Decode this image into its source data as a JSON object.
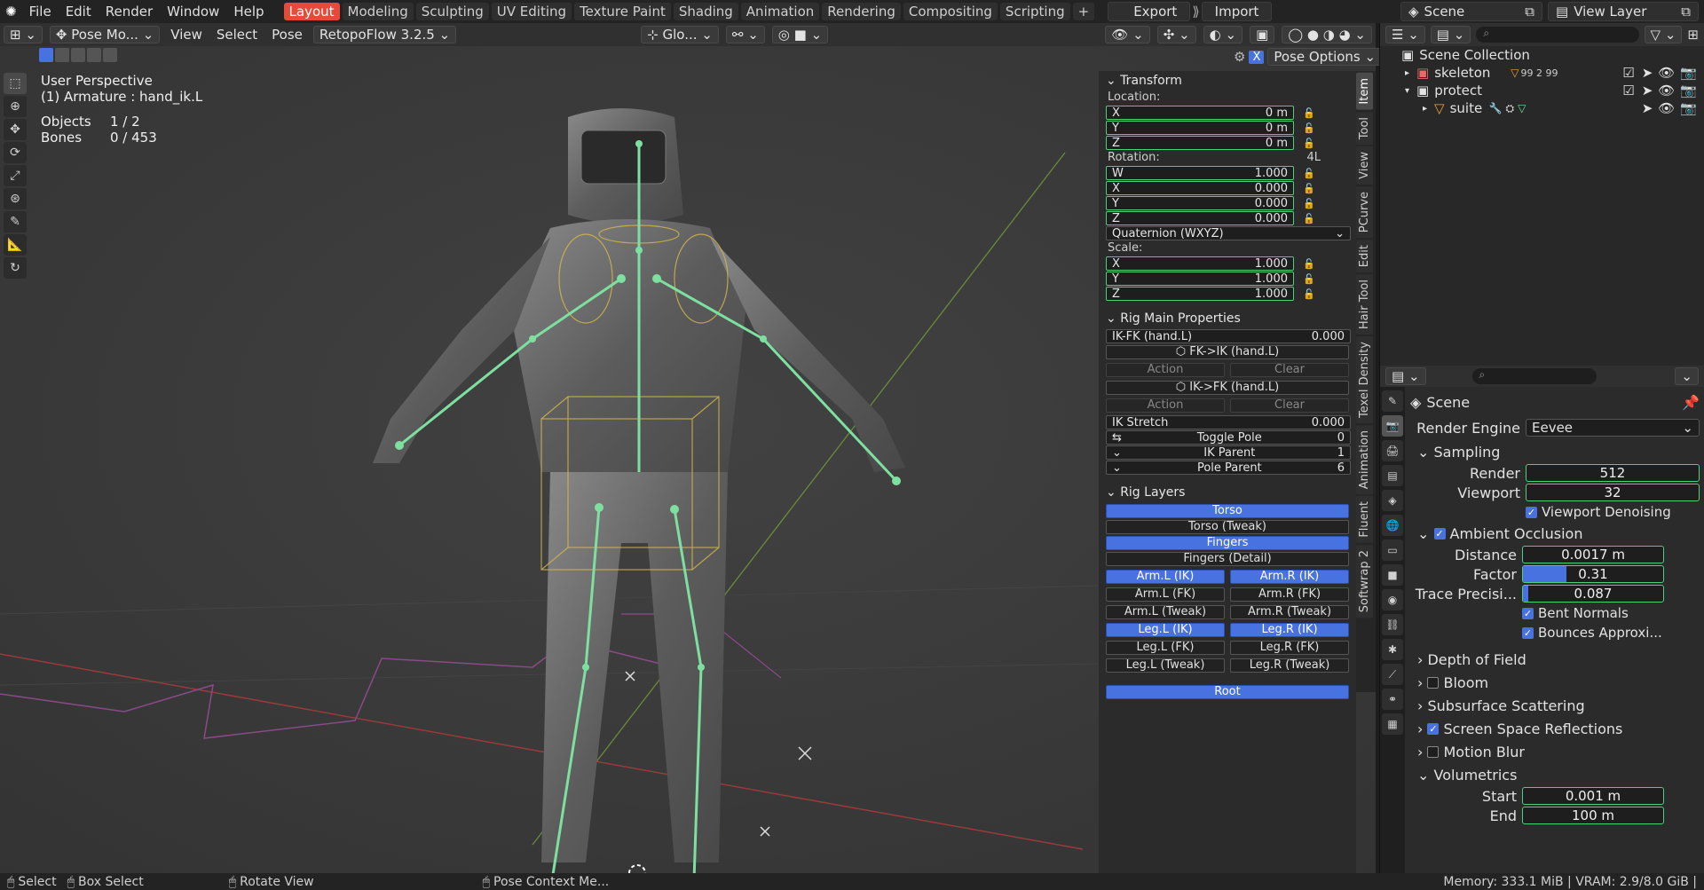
{
  "topbar": {
    "menus": [
      "File",
      "Edit",
      "Render",
      "Window",
      "Help"
    ],
    "workspaces": [
      "Layout",
      "Modeling",
      "Sculpting",
      "UV Editing",
      "Texture Paint",
      "Shading",
      "Animation",
      "Rendering",
      "Compositing",
      "Scripting"
    ],
    "active_workspace": "Layout",
    "export_label": "Export",
    "import_label": "Import",
    "scene": "Scene",
    "view_layer": "View Layer"
  },
  "viewport_header": {
    "mode": "Pose Mo...",
    "menus": [
      "View",
      "Select",
      "Pose"
    ],
    "addon": "RetopoFlow 3.2.5",
    "orientation": "Glo...",
    "pose_options": "Pose Options"
  },
  "viewport": {
    "perspective": "User Perspective",
    "armature": "(1) Armature : hand_ik.L",
    "objects_label": "Objects",
    "objects_value": "1 / 2",
    "bones_label": "Bones",
    "bones_value": "0 / 453"
  },
  "transform": {
    "title": "Transform",
    "location_label": "Location:",
    "location": [
      {
        "axis": "X",
        "value": "0 m"
      },
      {
        "axis": "Y",
        "value": "0 m"
      },
      {
        "axis": "Z",
        "value": "0 m"
      }
    ],
    "rotation_label": "Rotation:",
    "rotation_mode_short": "4L",
    "rotation": [
      {
        "axis": "W",
        "value": "1.000"
      },
      {
        "axis": "X",
        "value": "0.000"
      },
      {
        "axis": "Y",
        "value": "0.000"
      },
      {
        "axis": "Z",
        "value": "0.000"
      }
    ],
    "rotation_mode": "Quaternion (WXYZ)",
    "scale_label": "Scale:",
    "scale": [
      {
        "axis": "X",
        "value": "1.000"
      },
      {
        "axis": "Y",
        "value": "1.000"
      },
      {
        "axis": "Z",
        "value": "1.000"
      }
    ]
  },
  "rig_main": {
    "title": "Rig Main Properties",
    "ikfk_label": "IK-FK (hand.L)",
    "ikfk_value": "0.000",
    "fk_to_ik": "FK->IK (hand.L)",
    "ik_to_fk": "IK->FK (hand.L)",
    "action": "Action",
    "clear": "Clear",
    "ik_stretch_label": "IK Stretch",
    "ik_stretch_value": "0.000",
    "toggle_pole_label": "Toggle Pole",
    "toggle_pole_value": "0",
    "ik_parent_label": "IK Parent",
    "ik_parent_value": "1",
    "pole_parent_label": "Pole Parent",
    "pole_parent_value": "6"
  },
  "rig_layers": {
    "title": "Rig Layers",
    "torso": "Torso",
    "torso_tweak": "Torso (Tweak)",
    "fingers": "Fingers",
    "fingers_detail": "Fingers (Detail)",
    "pairs": [
      {
        "left": "Arm.L (IK)",
        "right": "Arm.R (IK)",
        "on": true
      },
      {
        "left": "Arm.L (FK)",
        "right": "Arm.R (FK)",
        "on": false
      },
      {
        "left": "Arm.L (Tweak)",
        "right": "Arm.R (Tweak)",
        "on": false
      },
      {
        "left": "Leg.L (IK)",
        "right": "Leg.R (IK)",
        "on": true
      },
      {
        "left": "Leg.L (FK)",
        "right": "Leg.R (FK)",
        "on": false
      },
      {
        "left": "Leg.L (Tweak)",
        "right": "Leg.R (Tweak)",
        "on": false
      }
    ],
    "root": "Root"
  },
  "vtabs": [
    "Item",
    "Tool",
    "View",
    "PCurve",
    "Edit",
    "Hair Tool",
    "Texel Density",
    "Animation",
    "Fluent",
    "Softwrap 2"
  ],
  "outliner": {
    "root": "Scene Collection",
    "rows": [
      {
        "name": "skeleton",
        "extra": "99 2  99"
      },
      {
        "name": "protect",
        "extra": ""
      },
      {
        "name": "suite",
        "extra": ""
      }
    ]
  },
  "properties": {
    "context": "Scene",
    "render_engine_label": "Render Engine",
    "render_engine": "Eevee",
    "sampling": "Sampling",
    "render_label": "Render",
    "render_value": "512",
    "viewport_label": "Viewport",
    "viewport_value": "32",
    "viewport_denoising": "Viewport Denoising",
    "ao": "Ambient Occlusion",
    "distance_label": "Distance",
    "distance_value": "0.0017 m",
    "factor_label": "Factor",
    "factor_value": "0.31",
    "factor_fraction": 0.31,
    "trace_label": "Trace Precisi...",
    "trace_value": "0.087",
    "bent_normals": "Bent Normals",
    "bounces": "Bounces Approxi...",
    "sections": [
      {
        "name": "Depth of Field",
        "check": null
      },
      {
        "name": "Bloom",
        "check": false
      },
      {
        "name": "Subsurface Scattering",
        "check": null
      },
      {
        "name": "Screen Space Reflections",
        "check": true
      },
      {
        "name": "Motion Blur",
        "check": false
      }
    ],
    "volumetrics": "Volumetrics",
    "start_label": "Start",
    "start_value": "0.001 m",
    "end_label": "End",
    "end_value": "100 m"
  },
  "statusbar": {
    "select": "Select",
    "box_select": "Box Select",
    "rotate_view": "Rotate View",
    "pose_context": "Pose Context Me...",
    "memory": "Memory: 333.1 MiB | VRAM: 2.9/8.0 GiB |"
  },
  "colors": {
    "accent_blue": "#4772e0",
    "active_tab": "#e64a3a",
    "bone_green": "#7ee0a0",
    "selection_yellow": "#e6c84a"
  }
}
